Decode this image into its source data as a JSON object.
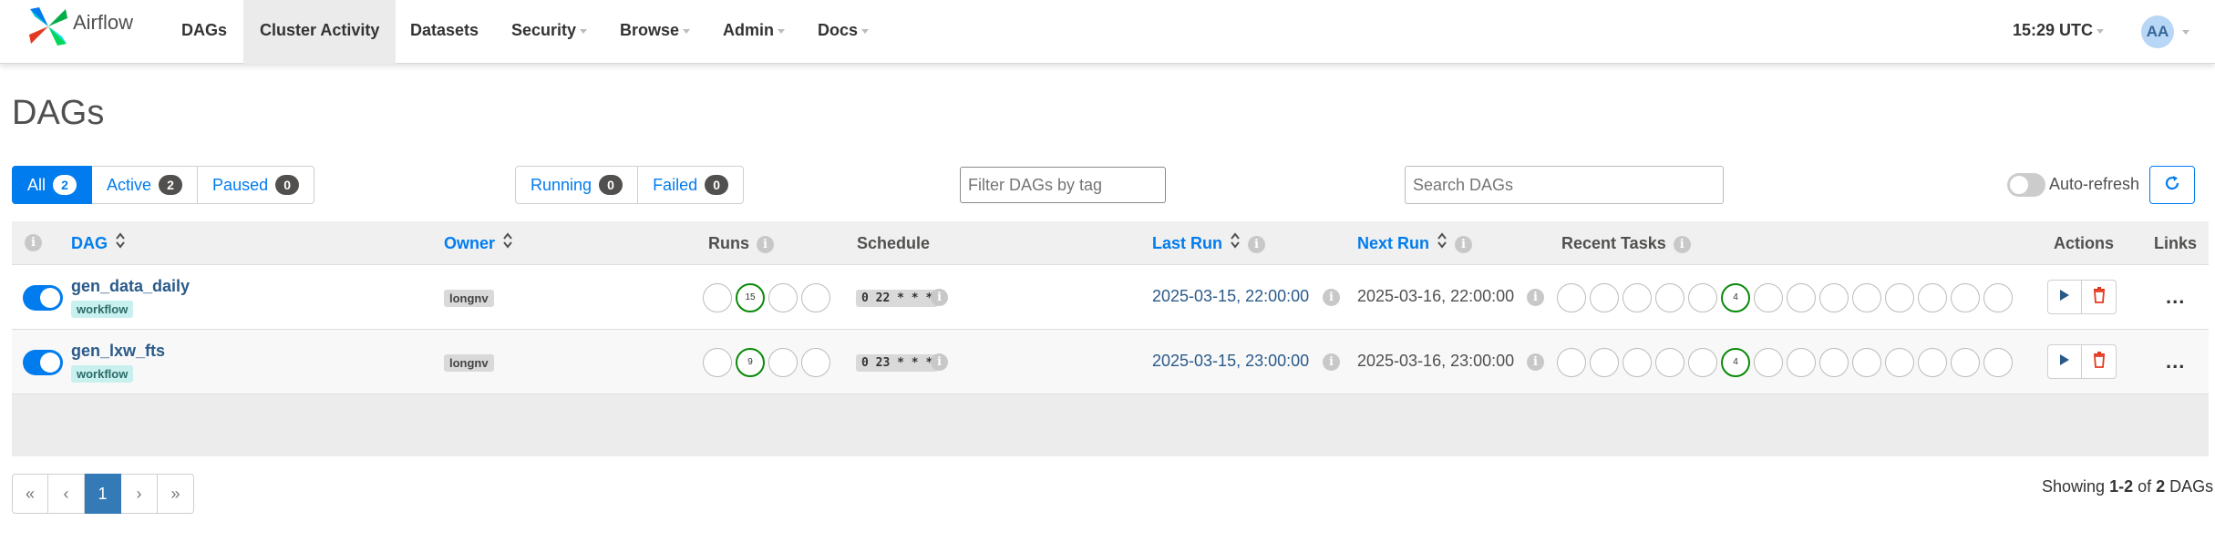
{
  "navbar": {
    "brand": "Airflow",
    "items": [
      {
        "label": "DAGs",
        "dropdown": false,
        "active": false
      },
      {
        "label": "Cluster Activity",
        "dropdown": false,
        "active": true
      },
      {
        "label": "Datasets",
        "dropdown": false,
        "active": false
      },
      {
        "label": "Security",
        "dropdown": true,
        "active": false
      },
      {
        "label": "Browse",
        "dropdown": true,
        "active": false
      },
      {
        "label": "Admin",
        "dropdown": true,
        "active": false
      },
      {
        "label": "Docs",
        "dropdown": true,
        "active": false
      }
    ],
    "time": "15:29 UTC",
    "user_initials": "AA"
  },
  "page": {
    "title": "DAGs"
  },
  "status_filter": {
    "all": {
      "label": "All",
      "count": "2"
    },
    "active": {
      "label": "Active",
      "count": "2"
    },
    "paused": {
      "label": "Paused",
      "count": "0"
    }
  },
  "run_filter": {
    "running": {
      "label": "Running",
      "count": "0"
    },
    "failed": {
      "label": "Failed",
      "count": "0"
    }
  },
  "tag_filter": {
    "placeholder": "Filter DAGs by tag"
  },
  "search": {
    "placeholder": "Search DAGs"
  },
  "auto_refresh": {
    "label": "Auto-refresh",
    "enabled": false
  },
  "table": {
    "headers": {
      "dag": "DAG",
      "owner": "Owner",
      "runs": "Runs",
      "schedule": "Schedule",
      "last_run": "Last Run",
      "next_run": "Next Run",
      "recent_tasks": "Recent Tasks",
      "actions": "Actions",
      "links": "Links"
    },
    "rows": [
      {
        "dag_id": "gen_data_daily",
        "tag": "workflow",
        "owner": "longnv",
        "runs_success": "15",
        "schedule": "0 22 * * *",
        "last_run": "2025-03-15, 22:00:00",
        "next_run": "2025-03-16, 22:00:00",
        "recent_tasks_success": "4",
        "links": "..."
      },
      {
        "dag_id": "gen_lxw_fts",
        "tag": "workflow",
        "owner": "longnv",
        "runs_success": "9",
        "schedule": "0 23 * * *",
        "last_run": "2025-03-15, 23:00:00",
        "next_run": "2025-03-16, 23:00:00",
        "recent_tasks_success": "4",
        "links": "..."
      }
    ]
  },
  "pagination": {
    "first": "«",
    "prev": "‹",
    "current": "1",
    "next": "›",
    "last": "»"
  },
  "summary": {
    "prefix": "Showing ",
    "range": "1-2",
    "of": " of ",
    "total": "2",
    "suffix": " DAGs"
  },
  "colors": {
    "accent": "#017cee",
    "success": "#088a08",
    "delete": "#e43921"
  }
}
